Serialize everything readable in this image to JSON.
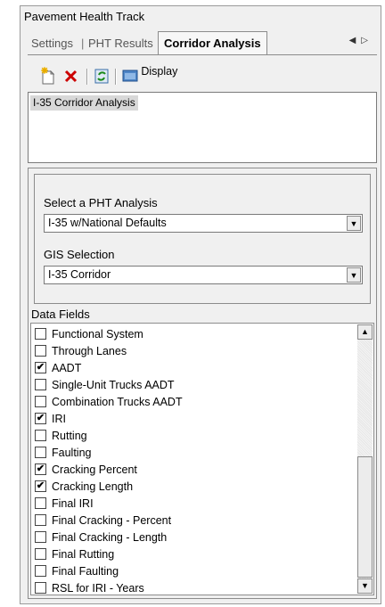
{
  "window": {
    "title": "Pavement Health Track"
  },
  "tabs": {
    "settings": "Settings",
    "pht_results": "PHT Results",
    "corridor_analysis": "Corridor Analysis",
    "separator": "|"
  },
  "toolbar": {
    "display_label": "Display",
    "icons": [
      "new-icon",
      "delete-icon",
      "refresh-icon",
      "display-icon"
    ],
    "accent": "#cc0000"
  },
  "analyses_list": {
    "items": [
      "I-35 Corridor Analysis"
    ],
    "selected": "I-35 Corridor Analysis"
  },
  "pht_analysis": {
    "label": "Select a PHT Analysis",
    "value": "I-35 w/National Defaults"
  },
  "gis_selection": {
    "label": "GIS Selection",
    "value": "I-35 Corridor"
  },
  "data_fields": {
    "label": "Data Fields",
    "checkmark": "✔",
    "items": [
      {
        "label": "Functional System",
        "checked": false
      },
      {
        "label": "Through Lanes",
        "checked": false
      },
      {
        "label": "AADT",
        "checked": true
      },
      {
        "label": "Single-Unit Trucks AADT",
        "checked": false
      },
      {
        "label": "Combination Trucks AADT",
        "checked": false
      },
      {
        "label": "IRI",
        "checked": true
      },
      {
        "label": "Rutting",
        "checked": false
      },
      {
        "label": "Faulting",
        "checked": false
      },
      {
        "label": "Cracking Percent",
        "checked": true
      },
      {
        "label": "Cracking Length",
        "checked": true
      },
      {
        "label": "Final IRI",
        "checked": false
      },
      {
        "label": "Final Cracking - Percent",
        "checked": false
      },
      {
        "label": "Final Cracking - Length",
        "checked": false
      },
      {
        "label": "Final Rutting",
        "checked": false
      },
      {
        "label": "Final Faulting",
        "checked": false
      },
      {
        "label": "RSL for IRI - Years",
        "checked": false
      }
    ]
  }
}
